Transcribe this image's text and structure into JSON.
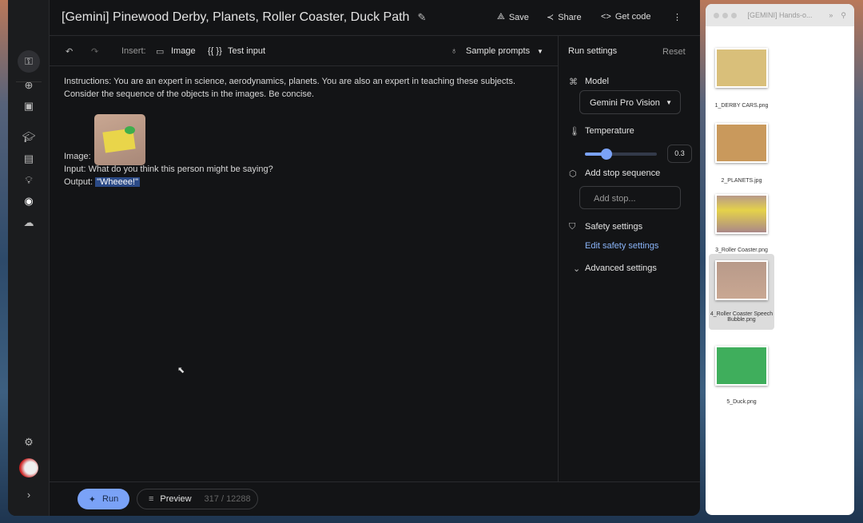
{
  "header": {
    "title": "[Gemini] Pinewood Derby, Planets, Roller Coaster, Duck Path",
    "save": "Save",
    "share": "Share",
    "get_code": "Get code"
  },
  "toolbar": {
    "insert": "Insert:",
    "image": "Image",
    "test_input_icon": "{{ }}",
    "test_input": "Test input",
    "sample_prompts": "Sample prompts"
  },
  "editor": {
    "instructions": "Instructions: You are an expert in science, aerodynamics, planets. You are also an expert in teaching these subjects. Consider the sequence of the objects in the images. Be concise.",
    "image_label": "Image:",
    "input": "Input: What do you think this person might be saying?",
    "output_label": "Output:",
    "output_value": "\"Wheeee!\""
  },
  "run_settings": {
    "title": "Run settings",
    "reset": "Reset",
    "model_label": "Model",
    "model_value": "Gemini Pro Vision",
    "temperature_label": "Temperature",
    "temperature_value": "0.3",
    "temperature_fraction": 0.3,
    "stop_label": "Add stop sequence",
    "stop_placeholder": "Add stop...",
    "safety_label": "Safety settings",
    "safety_link": "Edit safety settings",
    "advanced": "Advanced settings"
  },
  "footer": {
    "run": "Run",
    "preview": "Preview",
    "tokens": "317 / 12288"
  },
  "finder": {
    "title": "[GEMINI] Hands-o...",
    "files": [
      {
        "name": "1_DERBY CARS.png"
      },
      {
        "name": "2_PLANETS.jpg"
      },
      {
        "name": "3_Roller Coaster.png"
      },
      {
        "name": "4_Roller Coaster Speech Bubble.png"
      },
      {
        "name": "5_Duck.png"
      }
    ]
  },
  "colors": {
    "accent": "#7aa2f7",
    "link": "#8ab4f8"
  }
}
